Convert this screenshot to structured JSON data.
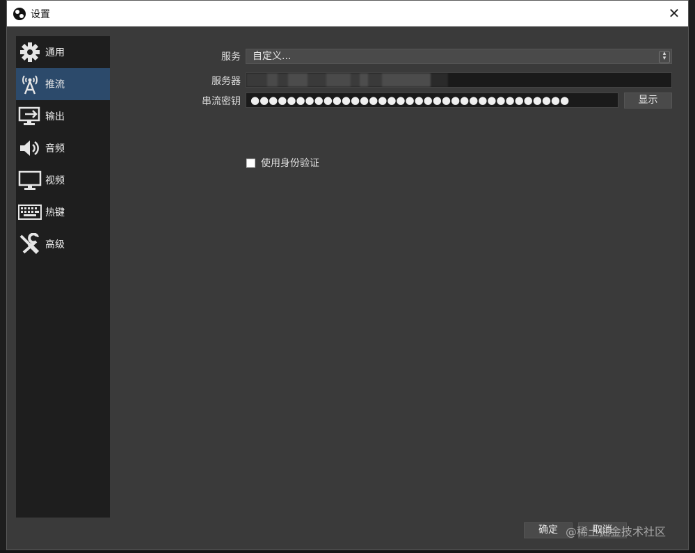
{
  "window": {
    "title": "设置"
  },
  "sidebar": {
    "items": [
      {
        "label": "通用",
        "icon": "gear-icon"
      },
      {
        "label": "推流",
        "icon": "broadcast-antenna-icon",
        "active": true
      },
      {
        "label": "输出",
        "icon": "monitor-output-icon"
      },
      {
        "label": "音频",
        "icon": "speaker-icon"
      },
      {
        "label": "视频",
        "icon": "monitor-icon"
      },
      {
        "label": "热键",
        "icon": "keyboard-icon"
      },
      {
        "label": "高级",
        "icon": "wrench-screwdriver-icon"
      }
    ]
  },
  "stream": {
    "service_label": "服务",
    "service_value": "自定义...",
    "server_label": "服务器",
    "key_label": "串流密钥",
    "key_value": "●●●●●●●●●●●●●●●●●●●●●●●●●●●●●●●●●●●",
    "show_button": "显示",
    "auth_label": "使用身份验证",
    "auth_checked": false
  },
  "footer": {
    "ok_label": "确定",
    "cancel_label": "取消",
    "watermark": "@稀土掘金技术社区"
  },
  "colors": {
    "active_item": "#2c4a6b",
    "panel_bg": "#3a3a3a",
    "sidebar_bg": "#1e1e1e"
  }
}
